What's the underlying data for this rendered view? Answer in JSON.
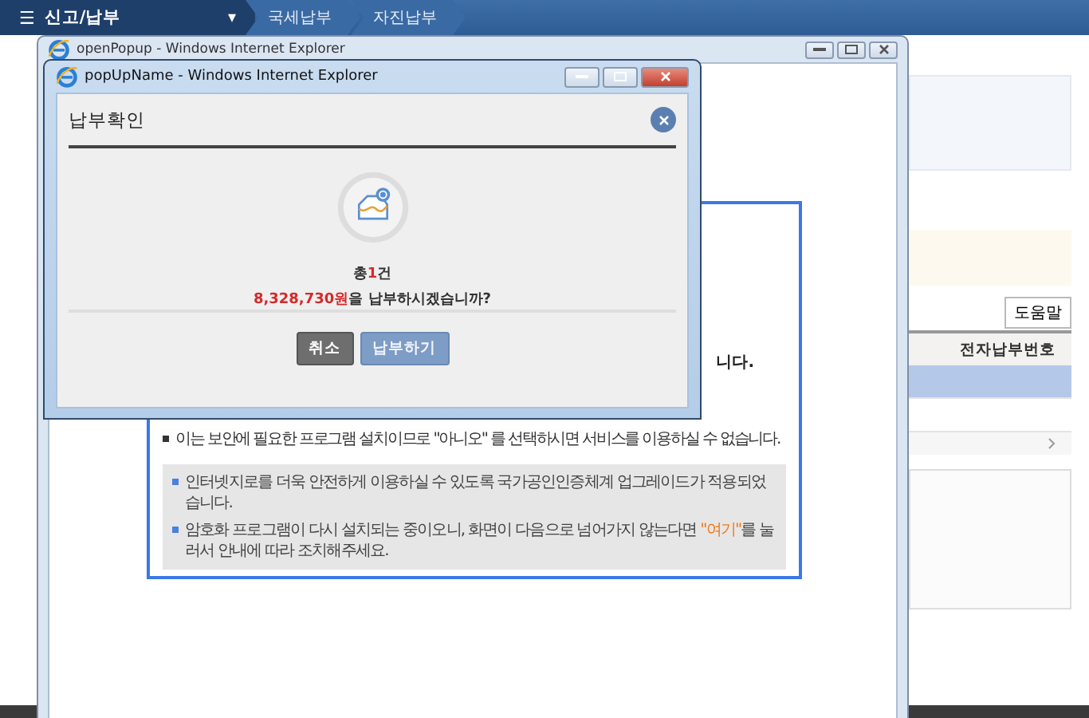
{
  "nav": {
    "menu_icon": "☰",
    "menu_label": "신고/납부",
    "caret": "▾",
    "breadcrumbs": [
      "국세납부",
      "자진납부"
    ]
  },
  "side": {
    "help_button": "도움말",
    "table": {
      "columns": [
        "전자납부번호"
      ],
      "rows": [
        {
          "selected": true
        },
        {
          "selected": false
        }
      ]
    }
  },
  "back_window": {
    "title": "openPopup - Windows Internet Explorer",
    "partial_line": "니다.",
    "notice": "이는 보안에 필요한 프로그램 설치이므로 \"아니오\" 를 선택하시면 서비스를 이용하실 수 없습니다.",
    "info": [
      {
        "text": "인터넷지로를 더욱 안전하게 이용하실 수 있도록 국가공인인증체계 업그레이드가 적용되었습니다."
      },
      {
        "text": "암호화 프로그램이 다시 설치되는 중이오니, 화면이 다음으로 넘어가지 않는다면 ",
        "link": "\"여기\"",
        "after": "를 눌러서 안내에 따라 조치해주세요."
      }
    ]
  },
  "popup": {
    "title": "popUpName - Windows Internet Explorer",
    "heading": "납부확인",
    "summary": {
      "prefix": "총",
      "count": "1",
      "suffix": "건"
    },
    "amount": {
      "value": "8,328,730원",
      "suffix": "을 납부하시겠습니까?"
    },
    "buttons": [
      {
        "label": "취소",
        "kind": "cancel"
      },
      {
        "label": "납부하기",
        "kind": "confirm"
      }
    ]
  }
}
